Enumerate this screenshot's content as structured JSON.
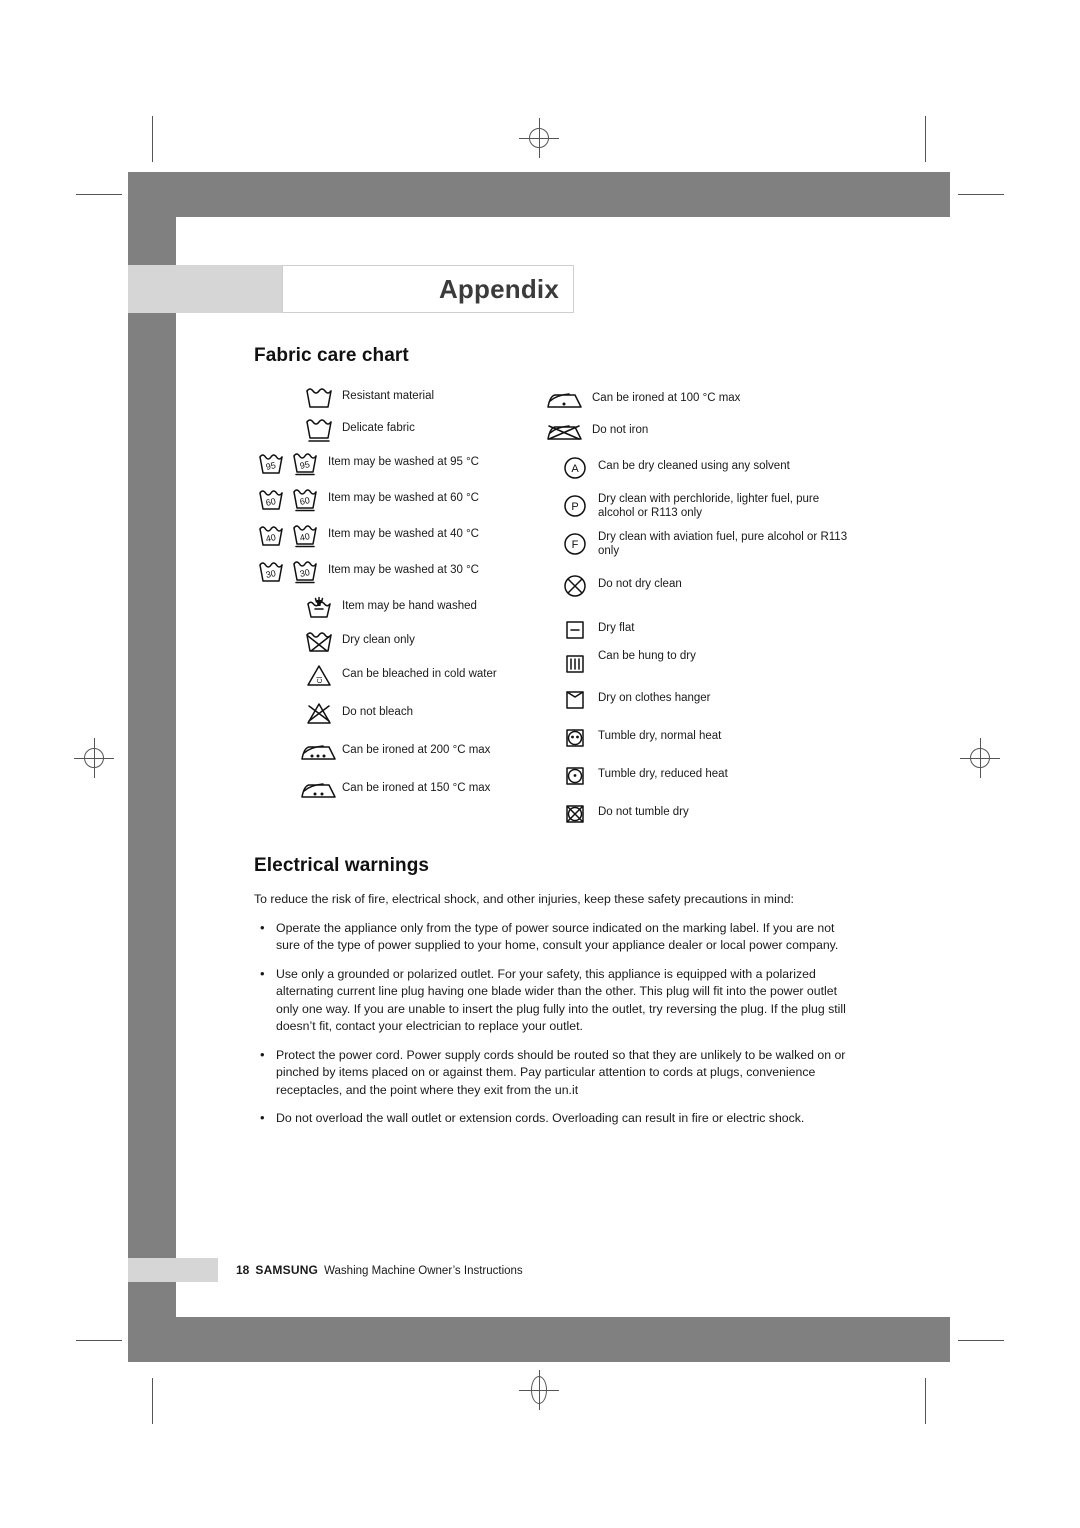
{
  "header": {
    "title": "Appendix"
  },
  "sections": {
    "fabric_care": {
      "heading": "Fabric care chart"
    },
    "electrical": {
      "heading": "Electrical warnings",
      "intro": "To reduce the risk of fire, electrical shock, and other injuries, keep these safety precautions in mind:",
      "bullets": [
        "Operate the appliance only from the type of power source indicated on the marking label. If you are not sure of the type of power supplied to your home, consult your appliance dealer or local power company.",
        "Use only a grounded or polarized outlet. For your safety, this appliance is equipped with a polarized alternating current line plug having one blade wider than the other. This plug will fit into the power outlet only one way. If you are unable to insert the plug fully into the outlet, try reversing the plug. If the plug still doesn’t fit, contact your electrician to replace your outlet.",
        "Protect the power cord. Power supply cords should be routed so that they are unlikely to be walked on or pinched by items placed on or against them. Pay particular attention to cords at plugs,  convenience receptacles, and the point where they exit from the un.it",
        "Do not overload the wall outlet or extension cords. Overloading can result in fire or electric shock."
      ]
    }
  },
  "fabric_chart": {
    "left_column": [
      {
        "icon": "washtub-icon",
        "label": "Resistant material"
      },
      {
        "icon": "washtub-underline-icon",
        "label": "Delicate fabric"
      },
      {
        "icon": "washtub-95-pair-icon",
        "label": "Item may be washed at 95 °C",
        "temp": "95"
      },
      {
        "icon": "washtub-60-pair-icon",
        "label": "Item may be washed at 60 °C",
        "temp": "60"
      },
      {
        "icon": "washtub-40-pair-icon",
        "label": "Item may be washed at 40 °C",
        "temp": "40"
      },
      {
        "icon": "washtub-30-pair-icon",
        "label": "Item may be washed at 30 °C",
        "temp": "30"
      },
      {
        "icon": "hand-wash-icon",
        "label": "Item may be hand washed"
      },
      {
        "icon": "dry-clean-only-icon",
        "label": "Dry clean only"
      },
      {
        "icon": "bleach-cold-water-icon",
        "label": "Can be bleached in cold water",
        "mark": "Cl"
      },
      {
        "icon": "do-not-bleach-icon",
        "label": "Do not bleach"
      },
      {
        "icon": "iron-three-dots-icon",
        "label": "Can be ironed at 200 °C  max"
      },
      {
        "icon": "iron-two-dots-icon",
        "label": "Can be ironed at 150 °C  max"
      }
    ],
    "right_column": [
      {
        "icon": "iron-one-dot-icon",
        "label": "Can be ironed at 100 °C  max"
      },
      {
        "icon": "do-not-iron-icon",
        "label": "Do not iron"
      },
      {
        "icon": "dry-clean-a-icon",
        "label": "Can be dry cleaned using any solvent",
        "mark": "A"
      },
      {
        "icon": "dry-clean-p-icon",
        "label": "Dry clean with perchloride, lighter fuel, pure alcohol or R113 only",
        "mark": "P"
      },
      {
        "icon": "dry-clean-f-icon",
        "label": "Dry clean with aviation fuel, pure alcohol or R113 only",
        "mark": "F"
      },
      {
        "icon": "do-not-dry-clean-icon",
        "label": "Do not dry clean"
      },
      {
        "icon": "dry-flat-icon",
        "label": "Dry flat"
      },
      {
        "icon": "hang-to-dry-icon",
        "label": "Can be hung to dry"
      },
      {
        "icon": "drip-dry-hanger-icon",
        "label": "Dry on clothes hanger"
      },
      {
        "icon": "tumble-dry-normal-icon",
        "label": "Tumble dry, normal heat"
      },
      {
        "icon": "tumble-dry-reduced-icon",
        "label": "Tumble dry, reduced heat"
      },
      {
        "icon": "do-not-tumble-dry-icon",
        "label": "Do not tumble dry"
      }
    ]
  },
  "footer": {
    "page_number": "18",
    "brand": "SAMSUNG",
    "subtitle": "Washing Machine Owner’s Instructions"
  },
  "colors": {
    "band_gray": "#808080",
    "light_gray": "#d6d6d6",
    "title_text": "#3b3b3b",
    "ink": "#111111"
  }
}
